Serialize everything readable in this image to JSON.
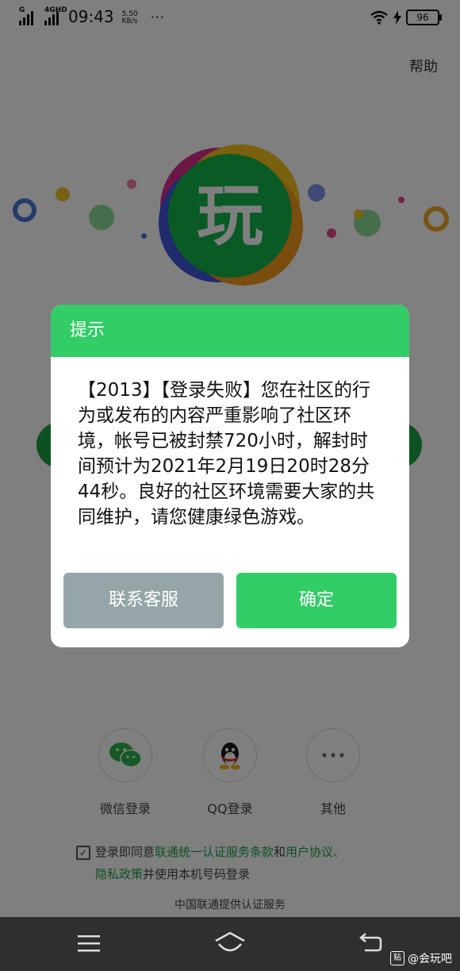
{
  "status_bar": {
    "signal_1": "G",
    "signal_2": "4GHD",
    "time": "09:43",
    "speed_value": "5.50",
    "speed_unit": "KB/s",
    "more": "···",
    "battery": "96"
  },
  "header": {
    "help_label": "帮助"
  },
  "logo": {
    "text": "玩"
  },
  "dialog": {
    "title": "提示",
    "message": "【2013】【登录失败】您在社区的行为或发布的内容严重影响了社区环境，帐号已被封禁720小时，解封时间预计为2021年2月19日20时28分44秒。良好的社区环境需要大家的共同维护，请您健康绿色游戏。",
    "contact_label": "联系客服",
    "confirm_label": "确定"
  },
  "social_login": [
    {
      "label": "微信登录",
      "icon": "wechat-icon"
    },
    {
      "label": "QQ登录",
      "icon": "qq-icon"
    },
    {
      "label": "其他",
      "icon": "more-icon"
    }
  ],
  "agreement": {
    "prefix": "登录即同意",
    "link1": "联通统一认证服务条款",
    "and": "和",
    "link2": "用户协议、",
    "link3": "隐私政策",
    "suffix": "并使用本机号码登录"
  },
  "provider_note": "中国联通提供认证服务",
  "watermark": {
    "badge": "贴",
    "text": "@会玩吧"
  },
  "colors": {
    "brand_green": "#32cd67",
    "grey_button": "#96a6a8",
    "link_green": "#1aa344"
  }
}
